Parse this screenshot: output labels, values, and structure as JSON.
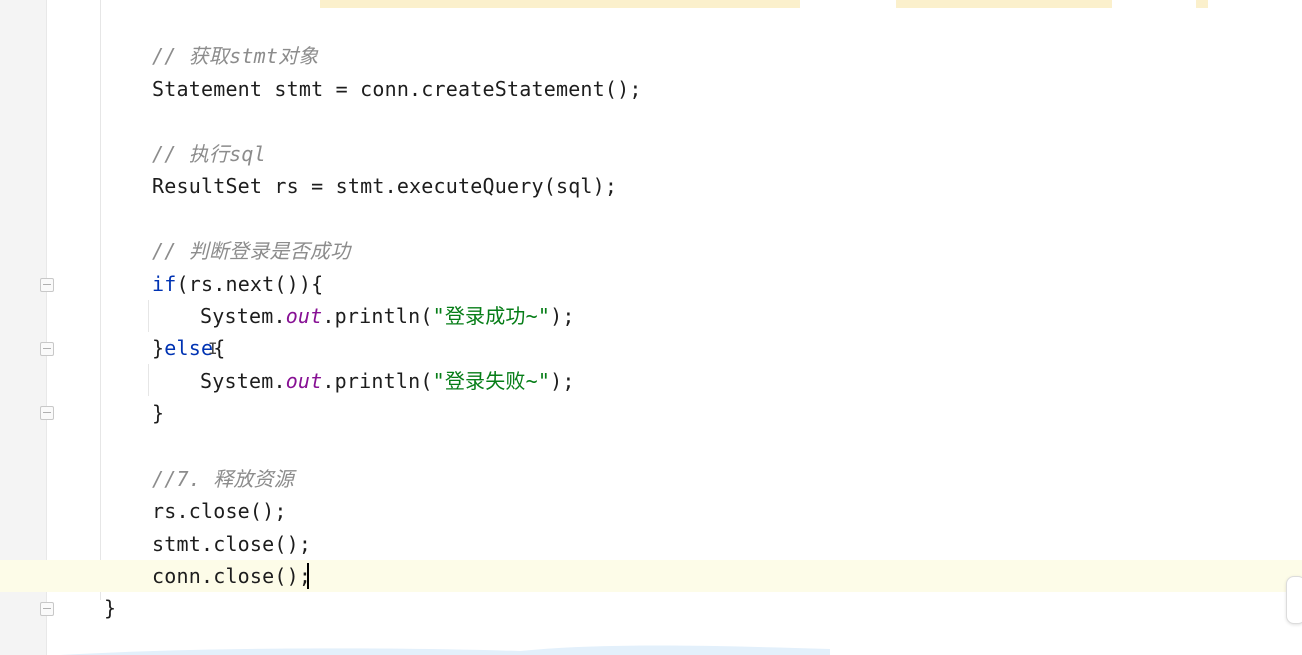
{
  "editor": {
    "lines": [
      {
        "id": "c1",
        "text": "// 获取stmt对象"
      },
      {
        "id": "l1",
        "text": "Statement stmt = conn.createStatement();"
      },
      {
        "id": "c2",
        "text": "// 执行sql"
      },
      {
        "id": "l2",
        "text": "ResultSet rs = stmt.executeQuery(sql);"
      },
      {
        "id": "c3",
        "text": "// 判断登录是否成功"
      },
      {
        "id": "l3_kw",
        "text": "if"
      },
      {
        "id": "l3_rest",
        "text": "(rs.next()){"
      },
      {
        "id": "l4_a",
        "text": "System."
      },
      {
        "id": "l4_field",
        "text": "out"
      },
      {
        "id": "l4_b",
        "text": ".println("
      },
      {
        "id": "l4_str",
        "text": "\"登录成功~\""
      },
      {
        "id": "l4_c",
        "text": ");"
      },
      {
        "id": "l5_a",
        "text": "}"
      },
      {
        "id": "l5_kw",
        "text": "else"
      },
      {
        "id": "l5_b",
        "text": "{"
      },
      {
        "id": "l6_a",
        "text": "System."
      },
      {
        "id": "l6_field",
        "text": "out"
      },
      {
        "id": "l6_b",
        "text": ".println("
      },
      {
        "id": "l6_str",
        "text": "\"登录失败~\""
      },
      {
        "id": "l6_c",
        "text": ");"
      },
      {
        "id": "l7",
        "text": "}"
      },
      {
        "id": "c4",
        "text": "//7. 释放资源"
      },
      {
        "id": "l8",
        "text": "rs.close();"
      },
      {
        "id": "l9",
        "text": "stmt.close();"
      },
      {
        "id": "l10",
        "text": "conn.close();"
      },
      {
        "id": "l11",
        "text": "}"
      }
    ]
  },
  "colors": {
    "comment": "#8c8c8c",
    "keyword": "#0033b3",
    "field": "#871094",
    "string": "#067d17",
    "current_line": "#fdfce8",
    "highlight": "#fbf0cc"
  }
}
